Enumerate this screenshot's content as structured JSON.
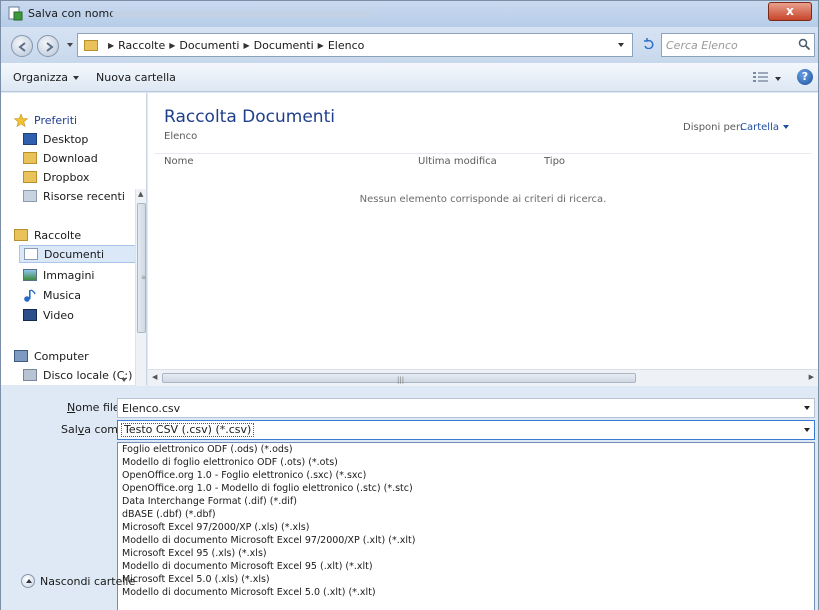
{
  "window": {
    "title": "Salva con nome",
    "close_label": "x"
  },
  "address": {
    "crumbs": [
      "Raccolte",
      "Documenti",
      "Documenti",
      "Elenco"
    ],
    "search_placeholder": "Cerca Elenco"
  },
  "toolbar": {
    "organize_label": "Organizza",
    "new_folder_label": "Nuova cartella",
    "help_label": "?"
  },
  "sidebar": {
    "favorites_label": "Preferiti",
    "favorites": [
      "Desktop",
      "Download",
      "Dropbox",
      "Risorse recenti"
    ],
    "libraries_label": "Raccolte",
    "libraries": [
      "Documenti",
      "Immagini",
      "Musica",
      "Video"
    ],
    "computer_label": "Computer",
    "drives": [
      "Disco locale (C:)"
    ]
  },
  "main": {
    "library_title": "Raccolta Documenti",
    "library_subtitle": "Elenco",
    "arrange_label": "Disponi per:",
    "arrange_value": "Cartella",
    "columns": [
      "Nome",
      "Ultima modifica",
      "Tipo"
    ],
    "empty_message": "Nessun elemento corrisponde ai criteri di ricerca."
  },
  "form": {
    "filename_label_pre": "N",
    "filename_label_post": "ome file:",
    "filename_value": "Elenco.csv",
    "savetype_label_pre": "Sal",
    "savetype_label_u": "v",
    "savetype_label_post": "a come:",
    "savetype_value": "Testo CSV (.csv) (*.csv)",
    "options": [
      "Foglio elettronico ODF (.ods) (*.ods)",
      "Modello di foglio elettronico ODF (.ots) (*.ots)",
      "OpenOffice.org 1.0 - Foglio elettronico (.sxc) (*.sxc)",
      "OpenOffice.org 1.0 - Modello di foglio elettronico (.stc) (*.stc)",
      "Data Interchange Format (.dif) (*.dif)",
      "dBASE (.dbf) (*.dbf)",
      "Microsoft Excel 97/2000/XP (.xls) (*.xls)",
      "Modello di documento Microsoft Excel 97/2000/XP (.xlt) (*.xlt)",
      "Microsoft Excel 95 (.xls) (*.xls)",
      "Modello di documento Microsoft Excel 95 (.xlt) (*.xlt)",
      "Microsoft Excel 5.0 (.xls) (*.xls)",
      "Modello di documento Microsoft Excel 5.0 (.xlt) (*.xlt)"
    ],
    "hide_folders_label": "Nascondi cartelle"
  },
  "colors": {
    "accent_title": "#1e3f8c",
    "link": "#1e4fa3",
    "selection": "#dbe8f8",
    "close": "#c7452b"
  }
}
